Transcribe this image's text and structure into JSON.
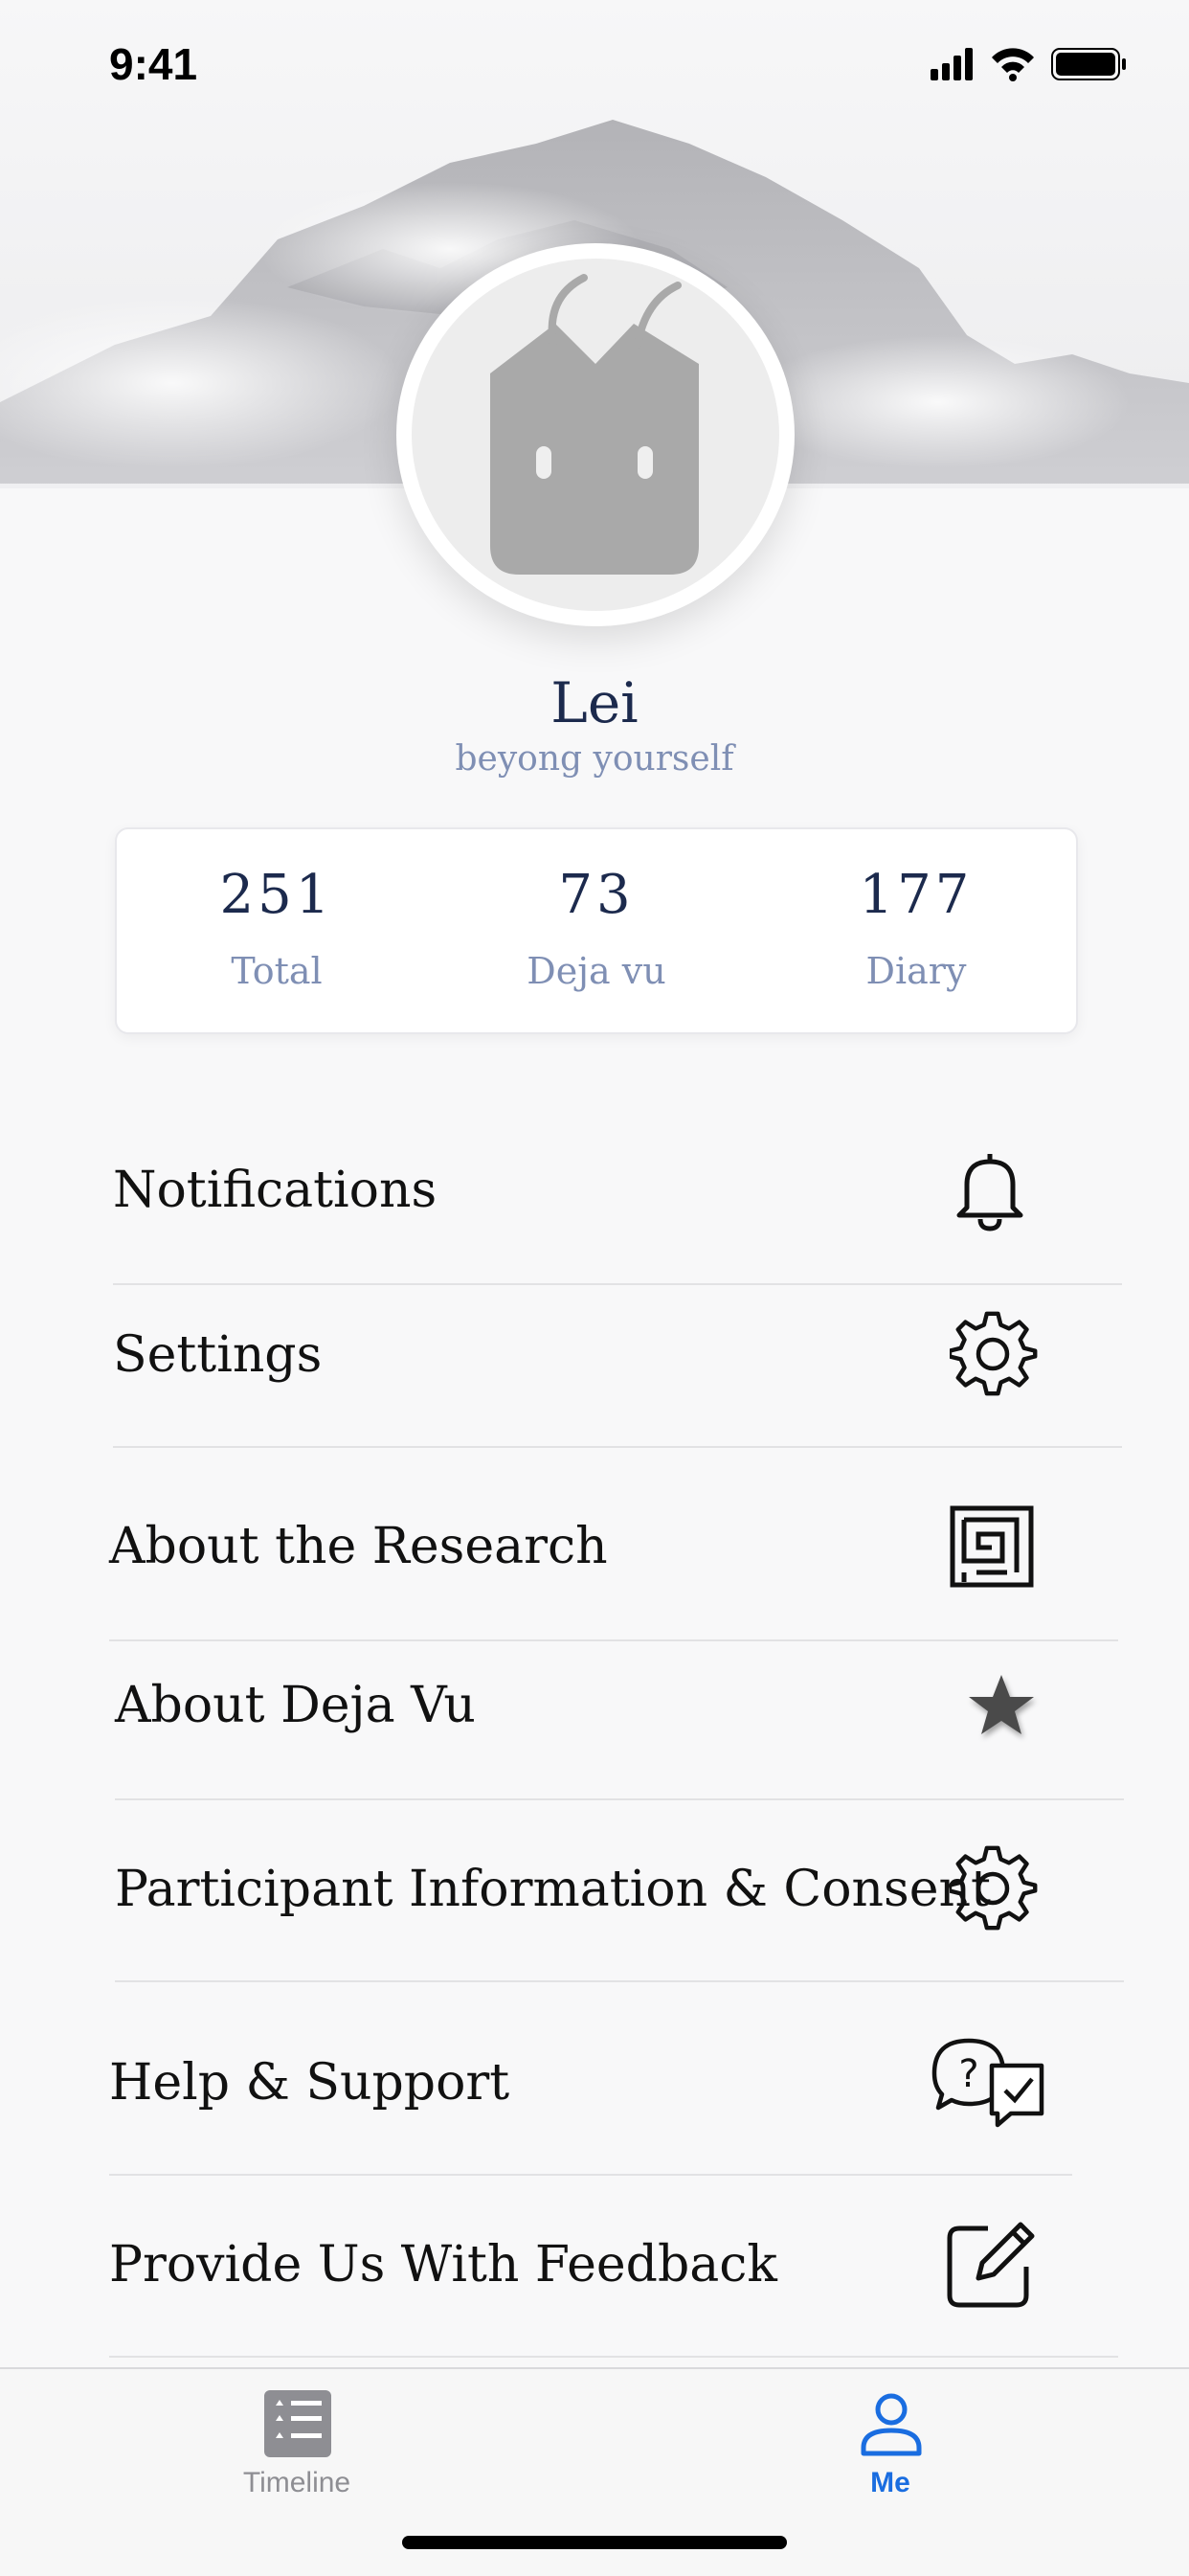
{
  "status_bar": {
    "time": "9:41",
    "icons": [
      "signal-icon",
      "wifi-icon",
      "battery-icon"
    ]
  },
  "profile": {
    "name": "Lei",
    "tagline": "beyong yourself"
  },
  "stats": [
    {
      "value": "251",
      "label": "Total"
    },
    {
      "value": "73",
      "label": "Deja vu"
    },
    {
      "value": "177",
      "label": "Diary"
    }
  ],
  "menu": [
    {
      "label": "Notifications",
      "icon": "bell-icon"
    },
    {
      "label": "Settings",
      "icon": "gear-icon"
    },
    {
      "label": "About the Research",
      "icon": "maze-icon"
    },
    {
      "label": "About Deja Vu",
      "icon": "star-icon"
    },
    {
      "label": "Participant Information & Consent",
      "icon": "gear-icon"
    },
    {
      "label": "Help & Support",
      "icon": "help-chat-icon"
    },
    {
      "label": "Provide Us With Feedback",
      "icon": "edit-icon"
    }
  ],
  "tab_bar": {
    "tabs": [
      {
        "label": "Timeline",
        "icon": "timeline-list-icon",
        "active": false
      },
      {
        "label": "Me",
        "icon": "person-icon",
        "active": true
      }
    ]
  },
  "colors": {
    "name": "#1c2a4d",
    "muted": "#7f8fb4",
    "active_tab": "#1a6de0",
    "inactive_tab": "#8e8e93"
  }
}
